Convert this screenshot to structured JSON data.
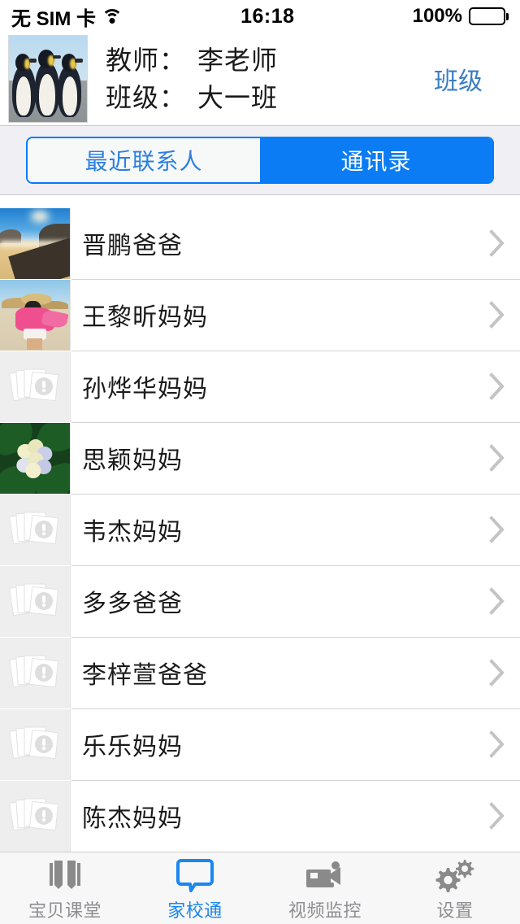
{
  "status_bar": {
    "carrier": "无 SIM 卡",
    "wifi_icon": "wifi-icon",
    "time": "16:18",
    "battery_percent": "100%",
    "battery_icon": "battery-full-icon"
  },
  "header": {
    "avatar_icon": "teacher-avatar-penguins",
    "teacher_label": "教师：",
    "teacher_name": "李老师",
    "class_label": "班级：",
    "class_name": "大一班",
    "class_button": "班级",
    "accent_color": "#3a7cc4"
  },
  "segmented": {
    "active_color": "#0b7cf4",
    "tabs": [
      {
        "label": "最近联系人",
        "active": false
      },
      {
        "label": "通讯录",
        "active": true
      }
    ]
  },
  "contacts": [
    {
      "name": "晋鹏爸爸",
      "avatar": "photo-beach",
      "chevron": "chevron-right-icon"
    },
    {
      "name": "王黎昕妈妈",
      "avatar": "photo-woman-pink",
      "chevron": "chevron-right-icon"
    },
    {
      "name": "孙烨华妈妈",
      "avatar": "photo-placeholder",
      "chevron": "chevron-right-icon"
    },
    {
      "name": "思颖妈妈",
      "avatar": "photo-hydrangea",
      "chevron": "chevron-right-icon"
    },
    {
      "name": "韦杰妈妈",
      "avatar": "photo-placeholder",
      "chevron": "chevron-right-icon"
    },
    {
      "name": "多多爸爸",
      "avatar": "photo-placeholder",
      "chevron": "chevron-right-icon"
    },
    {
      "name": "李梓萱爸爸",
      "avatar": "photo-placeholder",
      "chevron": "chevron-right-icon"
    },
    {
      "name": "乐乐妈妈",
      "avatar": "photo-placeholder",
      "chevron": "chevron-right-icon"
    },
    {
      "name": "陈杰妈妈",
      "avatar": "photo-placeholder",
      "chevron": "chevron-right-icon"
    }
  ],
  "tabbar": {
    "active_color": "#1b87f0",
    "inactive_color": "#8e8e93",
    "items": [
      {
        "label": "宝贝课堂",
        "icon": "book-icon",
        "active": false
      },
      {
        "label": "家校通",
        "icon": "chat-bubble-icon",
        "active": true
      },
      {
        "label": "视频监控",
        "icon": "video-camera-icon",
        "active": false
      },
      {
        "label": "设置",
        "icon": "gears-icon",
        "active": false
      }
    ]
  }
}
